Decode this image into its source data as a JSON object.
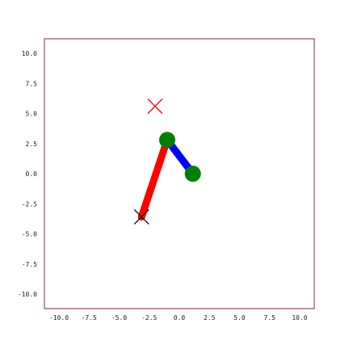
{
  "scene": {
    "x_range": [
      -10.0,
      10.0
    ],
    "y_range": [
      -10.0,
      10.0
    ],
    "x_ticks": [
      "-10.0",
      "-7.5",
      "-5.0",
      "-2.5",
      "0.0",
      "2.5",
      "5.0",
      "7.5",
      "10.0"
    ],
    "y_ticks": [
      "10.0",
      "7.5",
      "5.0",
      "2.5",
      "0.0",
      "-2.5",
      "-5.0",
      "-7.5",
      "-10.0"
    ],
    "frame_color": "#8b2252",
    "arm": {
      "base": [
        -2.8,
        -3.2
      ],
      "elbow": [
        -0.9,
        2.5
      ],
      "end_effector": [
        1.0,
        0.0
      ],
      "upper_link_color": "#ff0000",
      "lower_link_color": "#0000ff",
      "joint_color": "#008000"
    },
    "target": {
      "position": [
        -1.8,
        5.0
      ],
      "color": "#ff0000",
      "icon": "x-cross-icon"
    },
    "base_marker": {
      "position": [
        -2.8,
        -3.2
      ],
      "color": "#000000",
      "icon": "x-cross-icon"
    }
  }
}
